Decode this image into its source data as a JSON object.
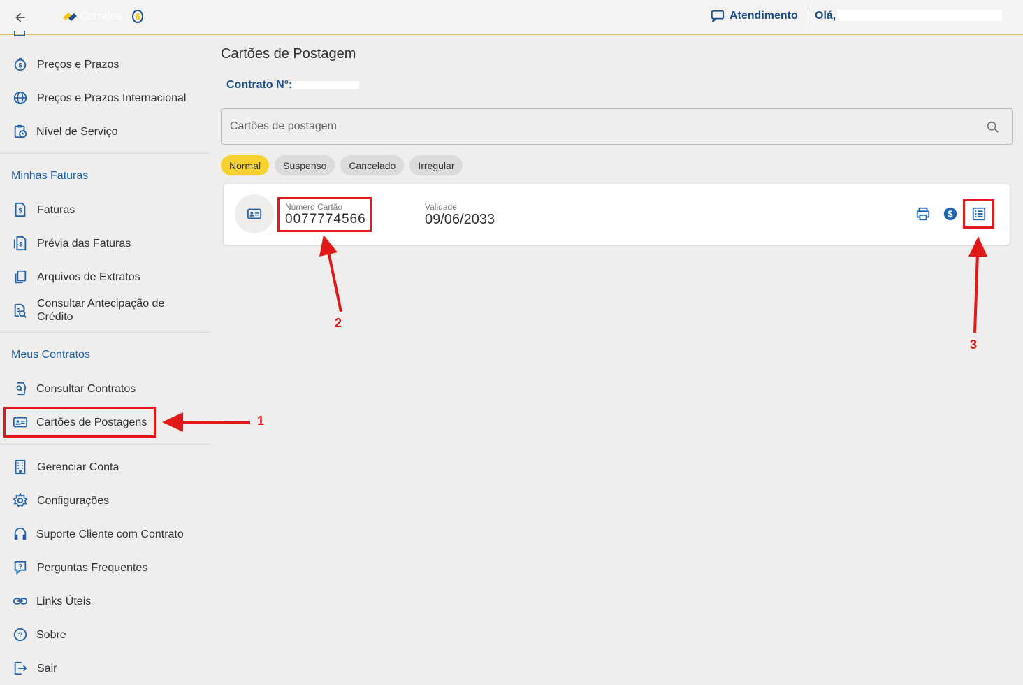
{
  "header": {
    "logo_text": "Correios",
    "logo_num": "360",
    "atendimento_label": "Atendimento",
    "greeting": "Olá,"
  },
  "sidebar": {
    "group1": [
      {
        "label": "Preços e Prazos",
        "icon": "dollar-stopwatch-icon"
      },
      {
        "label": "Preços e Prazos Internacional",
        "icon": "globe-icon"
      },
      {
        "label": "Nível de Serviço",
        "icon": "clipboard-clock-icon"
      }
    ],
    "section_faturas": "Minhas Faturas",
    "faturas": [
      {
        "label": "Faturas",
        "icon": "invoice-icon"
      },
      {
        "label": "Prévia das Faturas",
        "icon": "invoice-preview-icon"
      },
      {
        "label": "Arquivos de Extratos",
        "icon": "files-icon"
      },
      {
        "label": "Consultar Antecipação de",
        "label2": "Crédito",
        "icon": "search-dollar-icon"
      }
    ],
    "section_contratos": "Meus Contratos",
    "contratos": [
      {
        "label": "Consultar Contratos",
        "icon": "contract-search-icon"
      },
      {
        "label": "Cartões de Postagens",
        "icon": "id-card-icon"
      }
    ],
    "other": [
      {
        "label": "Gerenciar Conta",
        "icon": "building-icon"
      },
      {
        "label": "Configurações",
        "icon": "gear-icon"
      },
      {
        "label": "Suporte Cliente com Contrato",
        "icon": "headset-icon"
      },
      {
        "label": "Perguntas Frequentes",
        "icon": "question-chat-icon"
      },
      {
        "label": "Links Úteis",
        "icon": "link-icon"
      },
      {
        "label": "Sobre",
        "icon": "help-circle-icon"
      },
      {
        "label": "Sair",
        "icon": "logout-icon"
      }
    ]
  },
  "main": {
    "title": "Cartões de Postagem",
    "contract_label": "Contrato N°:",
    "search_placeholder": "Cartões de postagem",
    "filters": [
      "Normal",
      "Suspenso",
      "Cancelado",
      "Irregular"
    ],
    "active_filter": "Normal",
    "card": {
      "number_label": "Número Cartão",
      "number_value": "0077774566",
      "validity_label": "Validade",
      "validity_value": "09/06/2033"
    }
  },
  "annotations": [
    "1",
    "2",
    "3"
  ],
  "colors": {
    "accent_yellow": "#f6d230",
    "brand_blue": "#1b4f8a",
    "link_blue": "#1f63ab",
    "annotation_red": "#e11919"
  }
}
